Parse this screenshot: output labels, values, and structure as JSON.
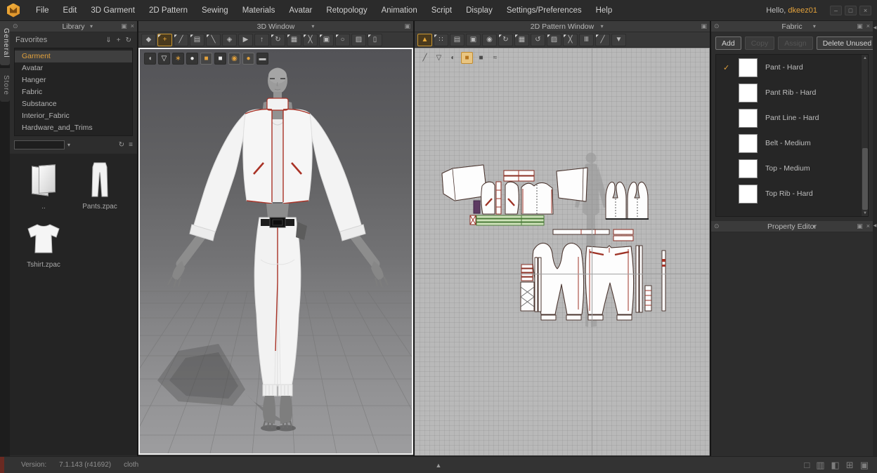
{
  "menubar": {
    "items": [
      "File",
      "Edit",
      "3D Garment",
      "2D Pattern",
      "Sewing",
      "Materials",
      "Avatar",
      "Retopology",
      "Animation",
      "Script",
      "Display",
      "Settings/Preferences",
      "Help"
    ]
  },
  "greeting": {
    "prefix": "Hello, ",
    "username": "dkeez01"
  },
  "window_controls": {
    "minimize": "–",
    "restore": "□",
    "close": "×"
  },
  "side_tabs": {
    "general": "General",
    "store": "Store"
  },
  "chrome_icons": {
    "pin": "⊙",
    "dropdown": "▾",
    "float": "▣",
    "close": "×"
  },
  "library": {
    "title": "Library",
    "favorites_label": "Favorites",
    "favorites_icons": {
      "download": "⇓",
      "add": "+",
      "refresh": "↻"
    },
    "items": [
      "Garment",
      "Avatar",
      "Hanger",
      "Fabric",
      "Substance",
      "Interior_Fabric",
      "Hardware_and_Trims"
    ],
    "search": {
      "value": "",
      "dropdown": "▾",
      "refresh": "↻",
      "view": "≡"
    },
    "thumbnails": [
      {
        "label": ".."
      },
      {
        "label": "Pants.zpac"
      },
      {
        "label": "Tshirt.zpac"
      }
    ]
  },
  "window3d": {
    "title": "3D Window",
    "toolbar": [
      {
        "name": "simulate",
        "glyph": "◆"
      },
      {
        "name": "select-move",
        "glyph": "+"
      },
      {
        "name": "edit-pinpoint",
        "glyph": "╱"
      },
      {
        "name": "select-garment",
        "glyph": "▤"
      },
      {
        "name": "edit-sewing",
        "glyph": "╲"
      },
      {
        "name": "symmetry",
        "glyph": "◈"
      },
      {
        "name": "drag",
        "glyph": "▶"
      },
      {
        "name": "avatar-raise",
        "glyph": "↑"
      },
      {
        "name": "reset-arrange",
        "glyph": "↻"
      },
      {
        "name": "grid-arrange",
        "glyph": "▦"
      },
      {
        "name": "pin",
        "glyph": "╳"
      },
      {
        "name": "steam-press",
        "glyph": "▣"
      },
      {
        "name": "gizmo",
        "glyph": "○"
      },
      {
        "name": "mannequin",
        "glyph": "▨"
      },
      {
        "name": "measure",
        "glyph": "▯"
      }
    ],
    "overlay": [
      {
        "name": "wig",
        "glyph": "◖"
      },
      {
        "name": "shirt",
        "glyph": "▽"
      },
      {
        "name": "gear",
        "glyph": "∗"
      },
      {
        "name": "bust",
        "glyph": "●"
      },
      {
        "name": "orange-fabric",
        "glyph": "■"
      },
      {
        "name": "white-fabric",
        "glyph": "■"
      },
      {
        "name": "orange-head",
        "glyph": "◉"
      },
      {
        "name": "orange-ball",
        "glyph": "●"
      },
      {
        "name": "press",
        "glyph": "▬"
      }
    ]
  },
  "window2d": {
    "title": "2D Pattern Window",
    "toolbar": [
      {
        "name": "transform-pattern",
        "glyph": "▲"
      },
      {
        "name": "edit-pattern",
        "glyph": "∷"
      },
      {
        "name": "trace",
        "glyph": "▤"
      },
      {
        "name": "edit-texture",
        "glyph": "▣"
      },
      {
        "name": "show-avatar",
        "glyph": "◉"
      },
      {
        "name": "flip-pattern",
        "glyph": "↻"
      },
      {
        "name": "grading",
        "glyph": "▦"
      },
      {
        "name": "edit-curvature",
        "glyph": "↺"
      },
      {
        "name": "sewing",
        "glyph": "▨"
      },
      {
        "name": "tack",
        "glyph": "╳"
      },
      {
        "name": "internal-line",
        "glyph": "Ⅲ"
      },
      {
        "name": "pen",
        "glyph": "╱"
      },
      {
        "name": "show-garment",
        "glyph": "▼"
      }
    ],
    "overlay": [
      {
        "name": "pen",
        "glyph": "╱"
      },
      {
        "name": "fabric-pin",
        "glyph": "▽"
      },
      {
        "name": "texture-ball",
        "glyph": "◐"
      },
      {
        "name": "orange-swatch",
        "glyph": "■"
      },
      {
        "name": "gray-swatch",
        "glyph": "■"
      },
      {
        "name": "steam",
        "glyph": "≈"
      }
    ]
  },
  "fabric": {
    "title": "Fabric",
    "check": "✓",
    "buttons": [
      {
        "label": "Add",
        "enabled": true
      },
      {
        "label": "Copy",
        "enabled": false
      },
      {
        "label": "Assign",
        "enabled": false
      },
      {
        "label": "Delete Unused",
        "enabled": true
      }
    ],
    "items": [
      {
        "label": "Pant - Hard",
        "checked": true
      },
      {
        "label": "Pant Rib - Hard",
        "checked": false
      },
      {
        "label": "Pant Line - Hard",
        "checked": false
      },
      {
        "label": "Belt - Medium",
        "checked": false
      },
      {
        "label": "Top - Medium",
        "checked": false
      },
      {
        "label": "Top Rib - Hard",
        "checked": false
      }
    ],
    "scroll_up": "▲",
    "scroll_down": "▼"
  },
  "property_editor": {
    "title": "Property Editor"
  },
  "statusbar": {
    "version_label": "Version:",
    "version": "7.1.143 (r41692)",
    "mode": "cloth",
    "expand": "▲",
    "layout_icons": [
      {
        "name": "layout-single",
        "glyph": "□"
      },
      {
        "name": "layout-split",
        "glyph": "▥"
      },
      {
        "name": "layout-mixed",
        "glyph": "◧"
      },
      {
        "name": "layout-quad",
        "glyph": "⊞"
      },
      {
        "name": "layout-preview",
        "glyph": "▣"
      }
    ]
  },
  "edge": {
    "collapse": "◀"
  },
  "colors": {
    "accent": "#E2A13C",
    "selection_blue": "#82B6E0",
    "pattern_red": "#8B2E22",
    "pattern_green": "#4A7A38",
    "viewport2d_bg": "#B9B9B9"
  }
}
